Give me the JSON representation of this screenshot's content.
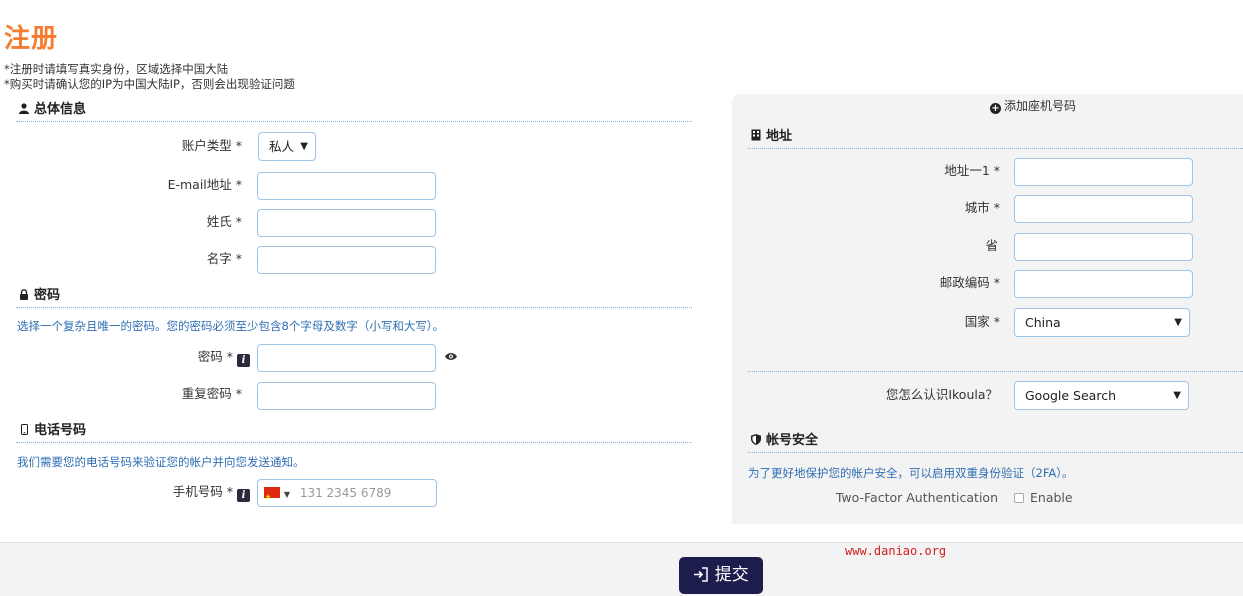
{
  "page": {
    "title": "注册",
    "notices": [
      "*注册时请填写真实身份，区域选择中国大陆",
      "*购买时请确认您的IP为中国大陆IP，否则会出现验证问题"
    ]
  },
  "general": {
    "heading": "总体信息",
    "account_type_label": "账户类型 *",
    "account_type_value": "私人",
    "email_label": "E-mail地址 *",
    "lastname_label": "姓氏 *",
    "firstname_label": "名字 *"
  },
  "password": {
    "heading": "密码",
    "hint": "选择一个复杂且唯一的密码。您的密码必须至少包含8个字母及数字（小写和大写）。",
    "password_label": "密码 *",
    "repeat_label": "重复密码 *"
  },
  "phone": {
    "heading": "电话号码",
    "hint": "我们需要您的电话号码来验证您的帐户并向您发送通知。",
    "mobile_label": "手机号码 *",
    "mobile_placeholder": "131 2345 6789"
  },
  "address": {
    "add_phone_link": "添加座机号码",
    "heading": "地址",
    "address1_label": "地址一1 *",
    "city_label": "城市 *",
    "province_label": "省",
    "postcode_label": "邮政编码 *",
    "country_label": "国家 *",
    "country_value": "China",
    "referral_label": "您怎么认识Ikoula？",
    "referral_value": "Google Search"
  },
  "security": {
    "heading": "帐号安全",
    "hint": "为了更好地保护您的帐户安全，可以启用双重身份验证（2FA）。",
    "twofa_label": "Two-Factor Authentication",
    "enable_label": "Enable"
  },
  "footer": {
    "submit_label": "提交",
    "watermark": "www.daniao.org"
  },
  "colors": {
    "title_orange": "#f47d31",
    "link_blue": "#2f6fb3",
    "submit_navy": "#1d1d4d"
  }
}
